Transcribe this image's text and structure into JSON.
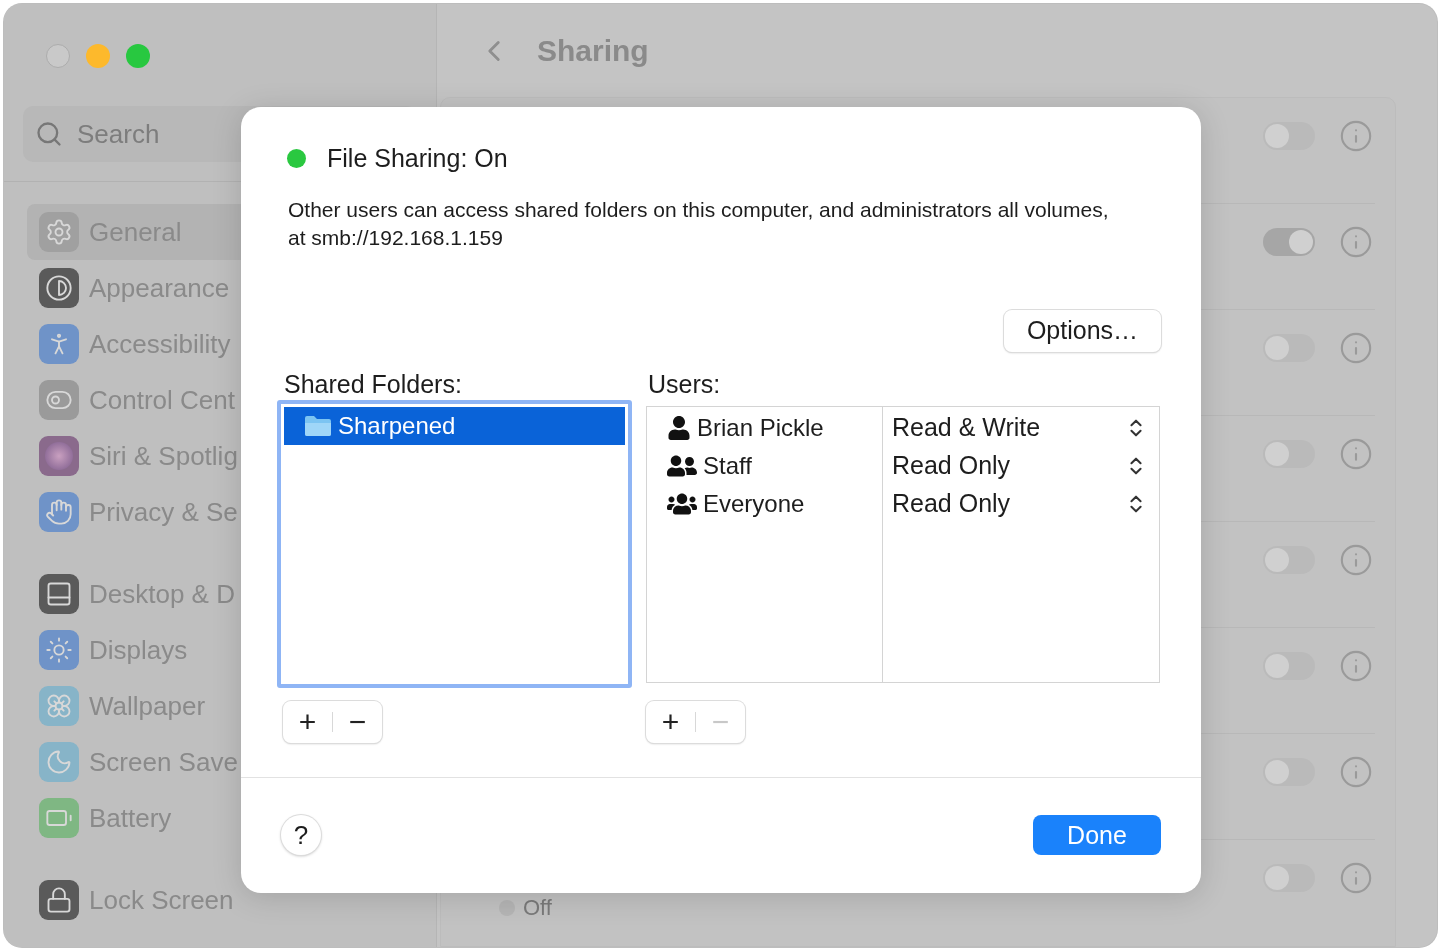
{
  "window": {
    "title": "Sharing"
  },
  "search": {
    "placeholder": "Search"
  },
  "sidebar": {
    "groups": [
      {
        "items": [
          {
            "label": "General",
            "selected": true
          },
          {
            "label": "Appearance",
            "selected": false
          },
          {
            "label": "Accessibility",
            "selected": false
          },
          {
            "label": "Control Cent",
            "selected": false
          },
          {
            "label": "Siri & Spotlig",
            "selected": false
          },
          {
            "label": "Privacy & Se",
            "selected": false
          }
        ]
      },
      {
        "items": [
          {
            "label": "Desktop & D",
            "selected": false
          },
          {
            "label": "Displays",
            "selected": false
          },
          {
            "label": "Wallpaper",
            "selected": false
          },
          {
            "label": "Screen Save",
            "selected": false
          },
          {
            "label": "Battery",
            "selected": false
          }
        ]
      },
      {
        "items": [
          {
            "label": "Lock Screen",
            "selected": false
          }
        ]
      }
    ]
  },
  "services": [
    {
      "on": false
    },
    {
      "on": true
    },
    {
      "on": false
    },
    {
      "on": false
    },
    {
      "on": false
    },
    {
      "on": false
    },
    {
      "on": false
    },
    {
      "on": false,
      "status": "Off"
    }
  ],
  "dialog": {
    "status": {
      "on": true,
      "label": "File Sharing: On"
    },
    "description": "Other users can access shared folders on this computer, and administrators all volumes, at smb://192.168.1.159",
    "options_button": "Options…",
    "shared_folders": {
      "label": "Shared Folders:",
      "items": [
        {
          "name": "Sharpened",
          "selected": true
        }
      ],
      "add": "+",
      "remove": "−",
      "remove_disabled": false
    },
    "users": {
      "label": "Users:",
      "rows": [
        {
          "name": "Brian Pickle",
          "kind": "user",
          "permission": "Read & Write"
        },
        {
          "name": "Staff",
          "kind": "group",
          "permission": "Read Only"
        },
        {
          "name": "Everyone",
          "kind": "everyone",
          "permission": "Read Only"
        }
      ],
      "add": "+",
      "remove": "−",
      "remove_disabled": true
    },
    "help_button": "?",
    "done_button": "Done"
  }
}
